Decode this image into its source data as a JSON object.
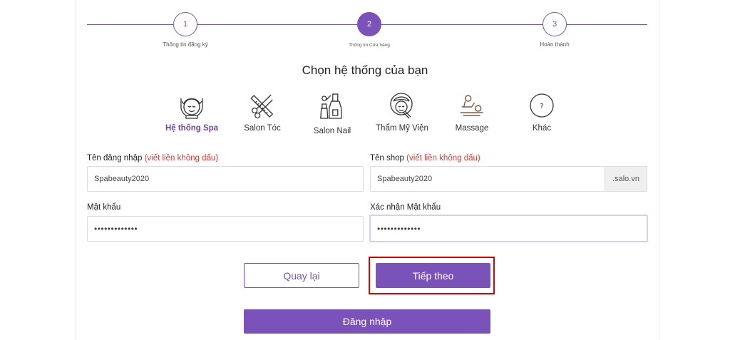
{
  "colors": {
    "accent": "#7b52b9",
    "hint": "#e53935",
    "highlight": "#e00000"
  },
  "stepper": {
    "steps": [
      {
        "number": "1",
        "label": "Thông tin đăng ký",
        "state": "inactive"
      },
      {
        "number": "2",
        "label": "Thông tin Cửa hàng",
        "state": "active"
      },
      {
        "number": "3",
        "label": "Hoàn thành",
        "state": "inactive"
      }
    ]
  },
  "title": "Chọn hệ thống của bạn",
  "systems": [
    {
      "label": "Hệ thống Spa",
      "icon": "spa-face-icon",
      "selected": true
    },
    {
      "label": "Salon Tóc",
      "icon": "scissors-comb-icon",
      "selected": false
    },
    {
      "label": "Salon Nail",
      "icon": "nail-polish-icon",
      "selected": false
    },
    {
      "label": "Thẩm Mỹ Viện",
      "icon": "beauty-face-icon",
      "selected": false
    },
    {
      "label": "Massage",
      "icon": "massage-stones-icon",
      "selected": false
    },
    {
      "label": "Khác",
      "icon": "question-icon",
      "selected": false
    }
  ],
  "form": {
    "username": {
      "label": "Tên đăng nhập",
      "hint": "(viết liền không dấu)",
      "value": "Spabeauty2020"
    },
    "shop": {
      "label": "Tên shop",
      "hint": "(viết liền không dấu)",
      "value": "Spabeauty2020",
      "suffix": ".salo.vn"
    },
    "password": {
      "label": "Mật khẩu",
      "value": "•••••••••••••"
    },
    "confirm": {
      "label": "Xác nhận Mật khẩu",
      "value": "•••••••••••••"
    }
  },
  "buttons": {
    "back": "Quay lại",
    "next": "Tiếp theo",
    "login": "Đăng nhập"
  }
}
